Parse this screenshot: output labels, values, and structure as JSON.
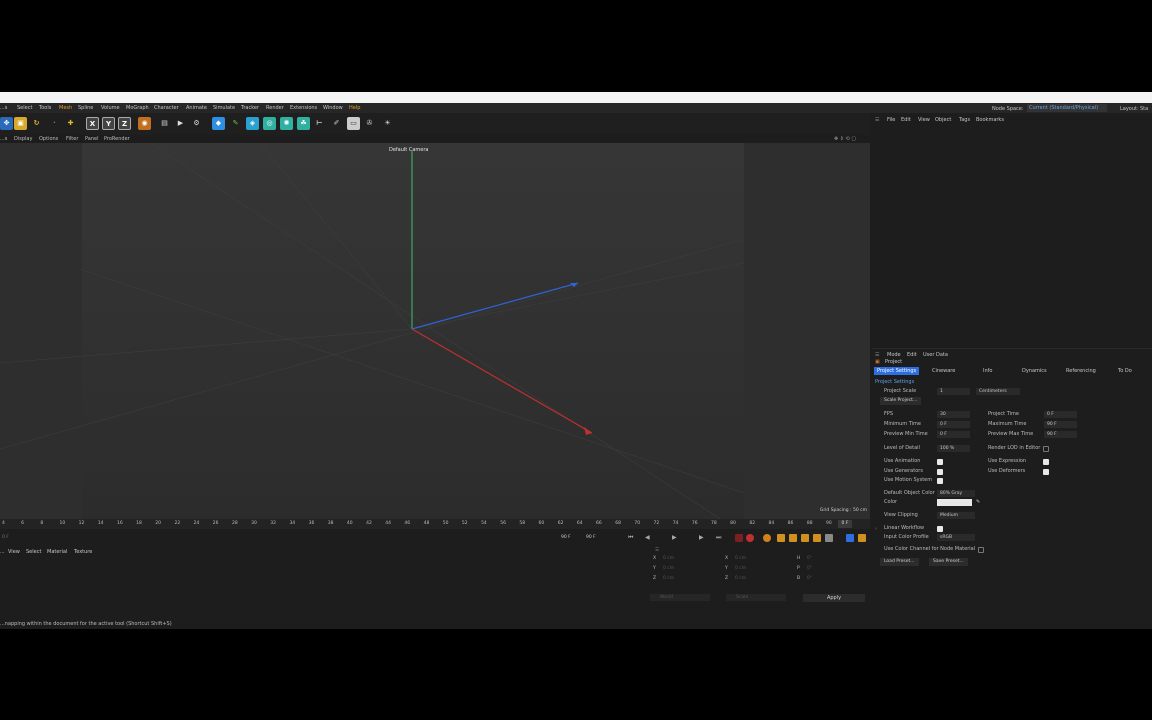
{
  "menu": {
    "items": [
      "...s",
      "Select",
      "Tools",
      "Mesh",
      "Spline",
      "Volume",
      "MoGraph",
      "Character",
      "Animate",
      "Simulate",
      "Tracker",
      "Render",
      "Extensions",
      "Window",
      "Help"
    ],
    "node_space_label": "Node Space:",
    "node_space_value": "Current (Standard/Physical)",
    "layout_label": "Layout:",
    "layout_value": "Sta"
  },
  "subbar": [
    "...s",
    "Display",
    "Options",
    "Filter",
    "Panel",
    "ProRender"
  ],
  "viewport": {
    "camera_label": "Default Camera",
    "grid_spacing": "Grid Spacing : 50 cm"
  },
  "timeline": {
    "ticks": [
      "4",
      "6",
      "8",
      "10",
      "12",
      "14",
      "16",
      "18",
      "20",
      "22",
      "24",
      "26",
      "28",
      "30",
      "32",
      "34",
      "36",
      "38",
      "40",
      "42",
      "44",
      "46",
      "48",
      "50",
      "52",
      "54",
      "56",
      "58",
      "60",
      "62",
      "64",
      "66",
      "68",
      "70",
      "72",
      "74",
      "76",
      "78",
      "80",
      "82",
      "84",
      "86",
      "88",
      "90"
    ],
    "current": "0 F"
  },
  "playback": {
    "start": "0 F",
    "end_a": "90 F",
    "end_b": "90 F"
  },
  "materials": {
    "items": [
      "...",
      "View",
      "Select",
      "Material",
      "Texture"
    ]
  },
  "coords": {
    "rows": [
      {
        "a": "X",
        "av": "0 cm",
        "b": "X",
        "bv": "0 cm",
        "c": "H",
        "cv": "0°"
      },
      {
        "a": "Y",
        "av": "0 cm",
        "b": "Y",
        "bv": "0 cm",
        "c": "P",
        "cv": "0°"
      },
      {
        "a": "Z",
        "av": "0 cm",
        "b": "Z",
        "bv": "0 cm",
        "c": "B",
        "cv": "0°"
      }
    ],
    "world": "World",
    "scale": "Scale",
    "apply": "Apply"
  },
  "status": "...napping within the document for the active tool (Shortcut Shift+S)",
  "objects_menu": [
    "File",
    "Edit",
    "View",
    "Object",
    "Tags",
    "Bookmarks"
  ],
  "attributes": {
    "menu": [
      "Mode",
      "Edit",
      "User Data"
    ],
    "title": "Project",
    "tabs": [
      "Project Settings",
      "Cineware",
      "Info",
      "Dynamics",
      "Referencing",
      "To Do"
    ],
    "section": "Project Settings",
    "project_scale_label": "Project Scale",
    "project_scale_value": "1",
    "project_scale_unit": "Centimeters",
    "scale_project_btn": "Scale Project...",
    "fps_label": "FPS",
    "fps_value": "30",
    "project_time_label": "Project Time",
    "project_time_value": "0 F",
    "min_time_label": "Minimum Time",
    "min_time_value": "0 F",
    "max_time_label": "Maximum Time",
    "max_time_value": "90 F",
    "prev_min_label": "Preview Min Time",
    "prev_min_value": "0 F",
    "prev_max_label": "Preview Max Time",
    "prev_max_value": "90 F",
    "lod_label": "Level of Detail",
    "lod_value": "100 %",
    "render_lod_label": "Render LOD in Editor",
    "use_animation": "Use Animation",
    "use_expression": "Use Expression",
    "use_generators": "Use Generators",
    "use_deformers": "Use Deformers",
    "use_motion": "Use Motion System",
    "default_color_label": "Default Object Color",
    "default_color_value": "80% Gray",
    "color_label": "Color",
    "view_clipping_label": "View Clipping",
    "view_clipping_value": "Medium",
    "linear_workflow": "Linear Workflow",
    "input_color_label": "Input Color Profile",
    "input_color_value": "sRGB",
    "use_color_channel": "Use Color Channel for Node Material",
    "load_preset": "Load Preset...",
    "save_preset": "Save Preset..."
  },
  "colors": {
    "accent": "#2d6ee0",
    "axis_x": "#c0302e",
    "axis_y": "#38c070",
    "axis_z": "#2f63d6"
  }
}
